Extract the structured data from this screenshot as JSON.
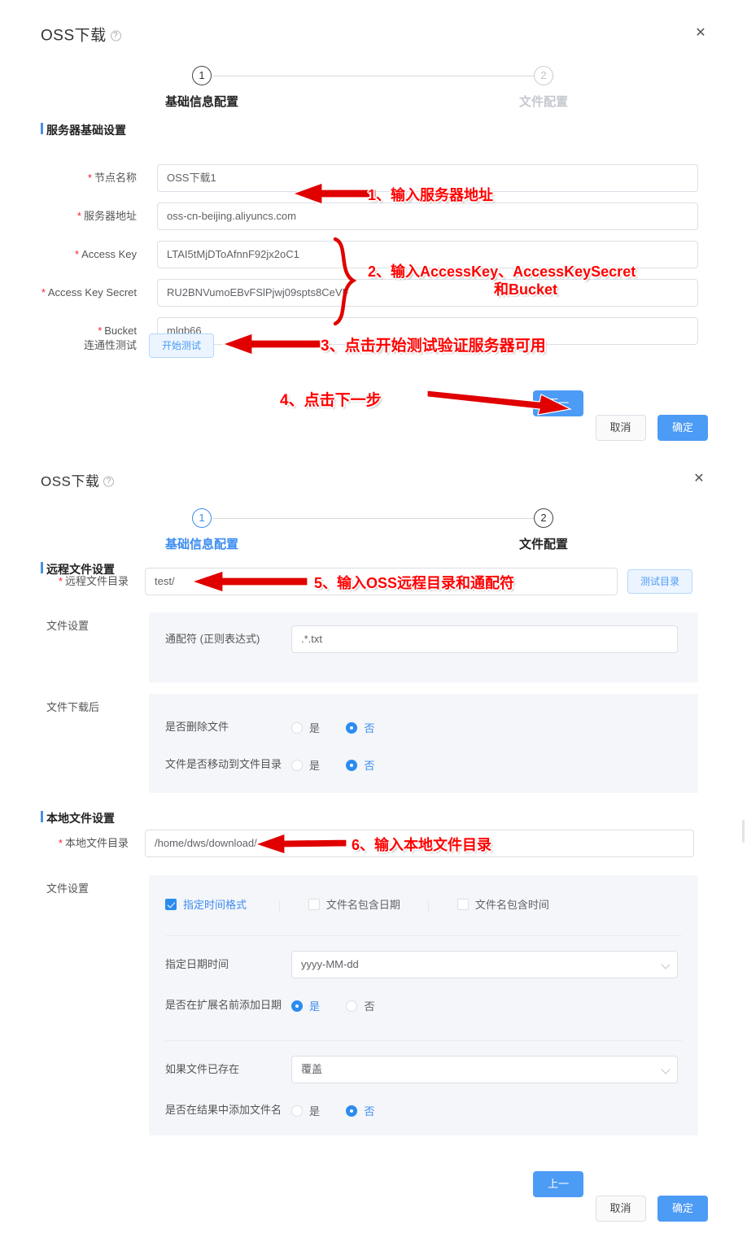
{
  "panel1": {
    "title": "OSS下载",
    "help_icon": "question-circle-icon",
    "close_icon": "close-icon",
    "steps": [
      {
        "num": "1",
        "label": "基础信息配置",
        "state": "active"
      },
      {
        "num": "2",
        "label": "文件配置",
        "state": "inactive"
      }
    ],
    "section_title": "服务器基础设置",
    "fields": [
      {
        "label": "节点名称",
        "required": true,
        "value": "OSS下载1"
      },
      {
        "label": "服务器地址",
        "required": true,
        "value": "oss-cn-beijing.aliyuncs.com"
      },
      {
        "label": "Access Key",
        "required": true,
        "value": "LTAI5tMjDToAfnnF92jx2oC1"
      },
      {
        "label": "Access Key Secret",
        "required": true,
        "value": "RU2BNVumoEBvFSlPjwj09spts8CeVF"
      },
      {
        "label": "Bucket",
        "required": true,
        "value": "mlgb66"
      }
    ],
    "connectivity": {
      "label": "连通性测试",
      "button": "开始测试"
    },
    "footer": {
      "next": "下一步",
      "cancel": "取消",
      "confirm": "确定"
    }
  },
  "panel2": {
    "title": "OSS下载",
    "help_icon": "question-circle-icon",
    "close_icon": "close-icon",
    "steps": [
      {
        "num": "1",
        "label": "基础信息配置",
        "state": "link"
      },
      {
        "num": "2",
        "label": "文件配置",
        "state": "active"
      }
    ],
    "remote_section_title": "远程文件设置",
    "remote_dir": {
      "label": "远程文件目录",
      "required": true,
      "value": "test/",
      "test_button": "测试目录"
    },
    "file_settings": {
      "outer_label": "文件设置",
      "wildcard_label": "通配符 (正则表达式)",
      "wildcard_value": ".*.txt"
    },
    "after_download": {
      "outer_label": "文件下载后",
      "rows": [
        {
          "label": "是否删除文件",
          "yes": "是",
          "no": "否",
          "selected": "no"
        },
        {
          "label": "文件是否移动到文件目录",
          "yes": "是",
          "no": "否",
          "selected": "no"
        }
      ]
    },
    "local_section_title": "本地文件设置",
    "local_dir": {
      "label": "本地文件目录",
      "required": true,
      "value": "/home/dws/download/"
    },
    "local_settings": {
      "outer_label": "文件设置",
      "checkboxes": [
        {
          "label": "指定时间格式",
          "checked": true
        },
        {
          "label": "文件名包含日期",
          "checked": false
        },
        {
          "label": "文件名包含时间",
          "checked": false
        }
      ],
      "date_format": {
        "label": "指定日期时间",
        "value": "yyyy-MM-dd"
      },
      "prefix_date": {
        "label": "是否在扩展名前添加日期",
        "yes": "是",
        "no": "否",
        "selected": "yes"
      },
      "if_exists": {
        "label": "如果文件已存在",
        "value": "覆盖"
      },
      "append_filename": {
        "label": "是否在结果中添加文件名",
        "yes": "是",
        "no": "否",
        "selected": "no"
      }
    },
    "footer": {
      "prev": "上一步",
      "cancel": "取消",
      "confirm": "确定"
    }
  },
  "annotations": [
    {
      "id": "a1",
      "text": "1、输入服务器地址"
    },
    {
      "id": "a2",
      "text": "2、输入AccessKey、AccessKeySecret"
    },
    {
      "id": "a2b",
      "text": "和Bucket"
    },
    {
      "id": "a3",
      "text": "3、点击开始测试验证服务器可用"
    },
    {
      "id": "a4",
      "text": "4、点击下一步"
    },
    {
      "id": "a5",
      "text": "5、输入OSS远程目录和通配符"
    },
    {
      "id": "a6",
      "text": "6、输入本地文件目录"
    }
  ],
  "colors": {
    "accent": "#4c9bf5",
    "annotation": "#ff0000",
    "required": "#f5222d",
    "panel_bg": "#f4f6fa",
    "border": "#dcdfe6"
  }
}
